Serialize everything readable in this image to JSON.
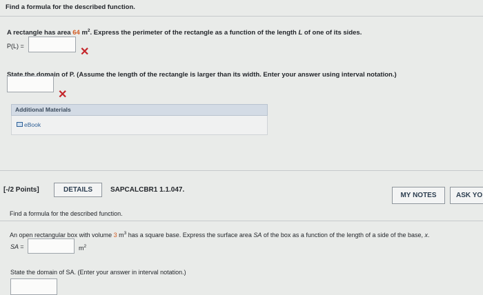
{
  "q1": {
    "instruction": "Find a formula for the described function.",
    "prompt_pre": "A rectangle has area ",
    "area_value": "64",
    "area_unit": " m",
    "area_exp": "2",
    "prompt_post": ". Express the perimeter of the rectangle as a function of the length ",
    "var_l": "L",
    "prompt_end": " of one of its sides.",
    "answer_label": "P(L) =",
    "answer_value": "",
    "domain_prompt": "State the domain of P. (Assume the length of the rectangle is larger than its width. Enter your answer using interval notation.)",
    "domain_value": "",
    "wrong_mark": "✕",
    "additional_materials": "Additional Materials",
    "ebook": "eBook"
  },
  "q2": {
    "points": "[-/2 Points]",
    "details": "DETAILS",
    "code": "SAPCALCBR1 1.1.047.",
    "my_notes": "MY NOTES",
    "ask": "ASK YO",
    "instruction": "Find a formula for the described function.",
    "prompt_pre": "An open rectangular box with volume ",
    "volume_value": "3",
    "volume_unit": " m",
    "volume_exp": "3",
    "prompt_mid": " has a square base. Express the surface area ",
    "var_sa": "SA",
    "prompt_mid2": " of the box as a function of the length of a side of the base, ",
    "var_x": "x",
    "prompt_end": ".",
    "answer_label": "SA =",
    "answer_value": "",
    "unit": "m",
    "unit_exp": "2",
    "domain_prompt": "State the domain of SA. (Enter your answer in interval notation.)",
    "domain_value": ""
  }
}
